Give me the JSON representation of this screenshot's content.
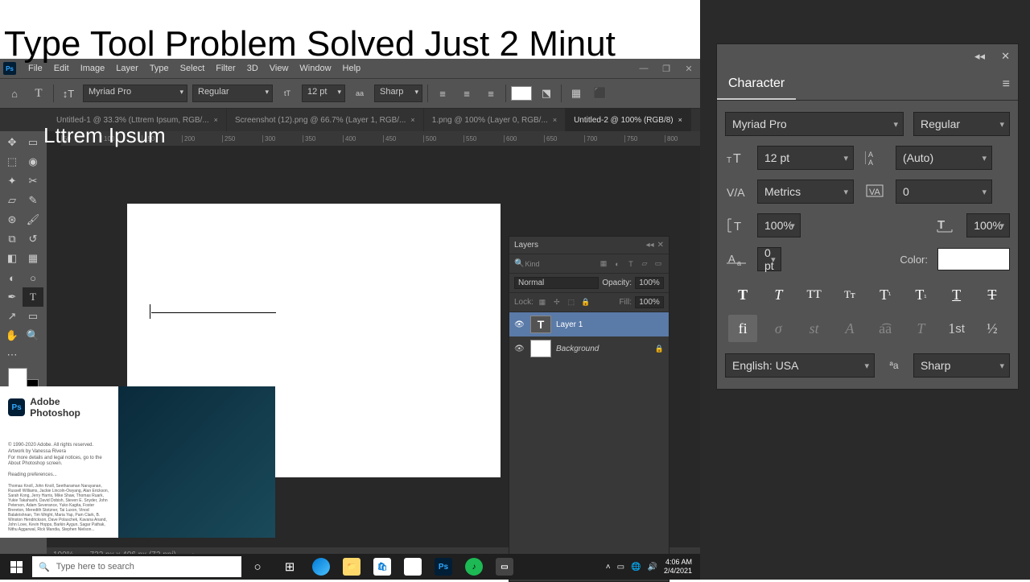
{
  "overlay": {
    "title": "Type Tool Problem Solved Just 2 Minut",
    "canvas_text": "Lttrem Ipsum"
  },
  "menubar": {
    "logo": "Ps",
    "items": [
      "File",
      "Edit",
      "Image",
      "Layer",
      "Type",
      "Select",
      "Filter",
      "3D",
      "View",
      "Window",
      "Help"
    ]
  },
  "options": {
    "font": "Myriad Pro",
    "style": "Regular",
    "size_icon": "T",
    "size": "12 pt",
    "aa": "Sharp"
  },
  "tabs": [
    {
      "label": "Untitled-1 @ 33.3% (Lttrem Ipsum, RGB/...",
      "active": false
    },
    {
      "label": "Screenshot (12).png @ 66.7% (Layer 1, RGB/...",
      "active": false
    },
    {
      "label": "1.png @ 100% (Layer 0, RGB/...",
      "active": false
    },
    {
      "label": "Untitled-2 @ 100% (RGB/8)",
      "active": true
    }
  ],
  "ruler": [
    "50",
    "100",
    "150",
    "200",
    "250",
    "300",
    "350",
    "400",
    "450",
    "500",
    "550",
    "600",
    "650",
    "700",
    "750",
    "800"
  ],
  "status": {
    "zoom": "100%",
    "doc": "722 px x 406 px (72 ppi)"
  },
  "layers": {
    "title": "Layers",
    "kind": "Kind",
    "blend": "Normal",
    "opacity_label": "Opacity:",
    "opacity": "100%",
    "lock_label": "Lock:",
    "fill_label": "Fill:",
    "fill": "100%",
    "list": [
      {
        "name": "Layer 1",
        "type": "T",
        "sel": true
      },
      {
        "name": "Background",
        "type": "bg",
        "sel": false
      }
    ]
  },
  "character": {
    "title": "Character",
    "font": "Myriad Pro",
    "style": "Regular",
    "size": "12 pt",
    "leading": "(Auto)",
    "kerning": "Metrics",
    "tracking": "0",
    "vscale": "100%",
    "hscale": "100%",
    "baseline": "0 pt",
    "color_label": "Color:",
    "lang": "English: USA",
    "aa": "Sharp"
  },
  "splash": {
    "name": "Adobe Photoshop",
    "copyright": "© 1990-2020 Adobe. All rights reserved.",
    "art": "Artwork by Vanessa Rivera",
    "info": "For more details and legal notices, go to the About Photoshop screen.",
    "loading": "Reading preferences...",
    "credits": "Thomas Knoll, John Knoll, Seetharaman Narayanan, Russell Williams, Jackie Lincoln-Owyang, Alan Erickson, Sarah Kong, Jerry Harris, Mike Shaw, Thomas Ruark, Yukie Takahashi, David Dobish, Steven E. Snyder, John Peterson, Adam Severance, Yuko Kagita, Foster Brereton, Meredith Stotzner, Tai Luxon, Vinod Balakrishnan, Tim Wright, Maria Yap, Pam Clark, B. Winston Hendrickson, Dave Polaschek, Kavana Anand, John Love, Kevin Hopps, Barkin Aygun, Sagar Pathak, Nithu Aggarwal, Rick Mandia, Stephen Nielson..."
  },
  "taskbar": {
    "search_placeholder": "Type here to search",
    "time": "4:06 AM",
    "date": "2/4/2021"
  }
}
